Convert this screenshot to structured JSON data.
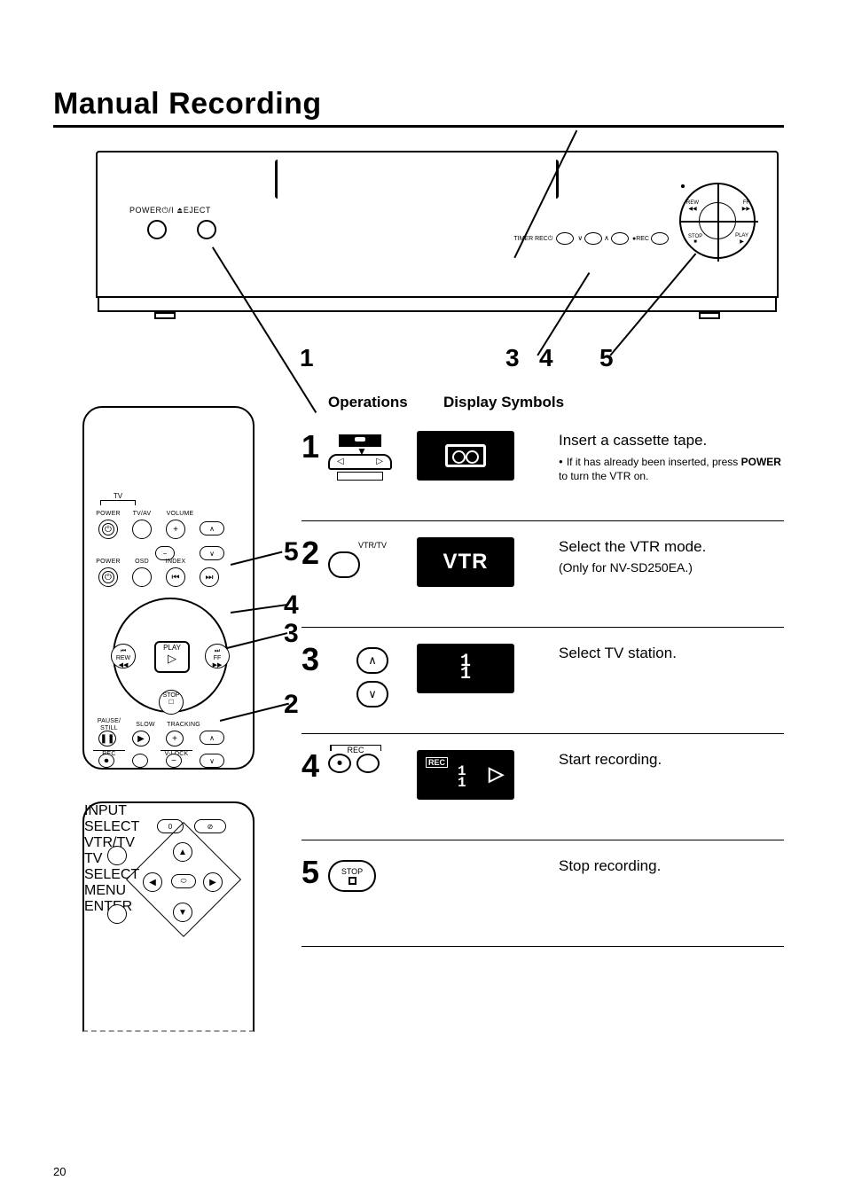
{
  "title": "Manual Recording",
  "page_number": "20",
  "vcr_labels": {
    "power_eject": "POWER⏻/I  ⏏EJECT",
    "timer_rec": "TIMER REC⏻",
    "rec": "●REC"
  },
  "vcr_callouts": {
    "n1": "1",
    "n3": "3",
    "n4": "4",
    "n5": "5"
  },
  "remote": {
    "tv_bracket": "TV",
    "power": "POWER",
    "tvav": "TV/AV",
    "volume": "VOLUME",
    "power2": "POWER",
    "osd": "OSD",
    "index": "INDEX",
    "play": "PLAY",
    "rew_top": "⏮",
    "rew": "REW",
    "rew_ic": "◀◀",
    "ff_top": "⏭",
    "ff": "FF",
    "ff_ic": "▶▶",
    "stop": "STOP",
    "pause": "PAUSE/\nSTILL",
    "slow": "SLOW",
    "tracking": "TRACKING",
    "rec": "REC",
    "vlock": "V-LOCK"
  },
  "remote2": {
    "input": "INPUT SELECT",
    "vtrtv": "VTR/TV",
    "tvselect": "TV SELECT",
    "menu": "MENU",
    "enter": "ENTER"
  },
  "side_callouts": {
    "n2": "2",
    "n3": "3",
    "n4": "4",
    "n5": "5"
  },
  "headers": {
    "ops": "Operations",
    "disp": "Display Symbols"
  },
  "steps": [
    {
      "num": "1",
      "disp_type": "cassette",
      "desc_main": "Insert a cassette tape.",
      "desc_note": "If it has already been inserted, press <strong>POWER</strong> to turn the VTR on."
    },
    {
      "num": "2",
      "op_label": "VTR/TV",
      "disp_type": "vtr",
      "disp_text": "VTR",
      "desc_main": "Select the VTR mode.",
      "desc_sub": "(Only for NV-SD250EA.)"
    },
    {
      "num": "3",
      "disp_type": "ch",
      "disp_text": "1",
      "desc_main": "Select TV station."
    },
    {
      "num": "4",
      "op_label": "REC",
      "disp_type": "rec",
      "disp_rec": "REC",
      "disp_ch": "1",
      "desc_main": "Start recording."
    },
    {
      "num": "5",
      "op_label": "STOP",
      "desc_main": "Stop recording."
    }
  ]
}
